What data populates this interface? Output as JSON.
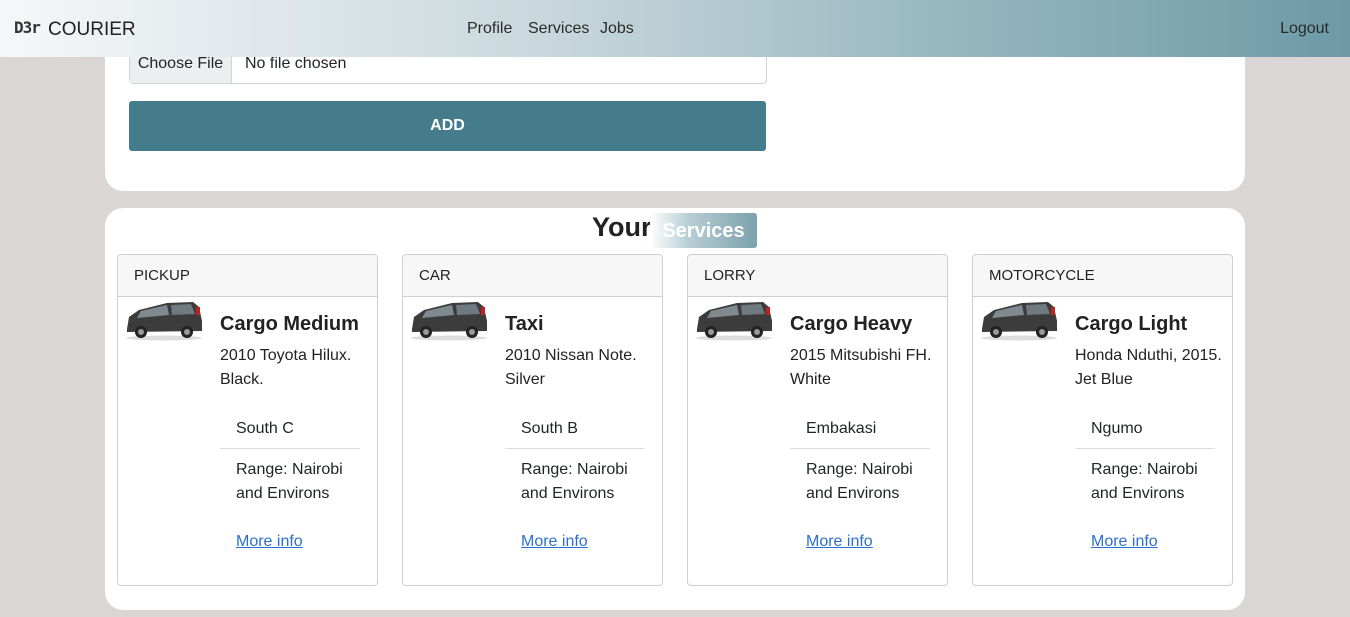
{
  "nav": {
    "logo": "D3r",
    "brand": "COURIER",
    "links": [
      "Profile",
      "Services",
      "Jobs"
    ],
    "logout": "Logout"
  },
  "form": {
    "file_button": "Choose File",
    "file_status": "No file chosen",
    "add_label": "ADD"
  },
  "services": {
    "title_part1": "Your",
    "title_part2": "Services",
    "items": [
      {
        "category": "PICKUP",
        "name": "Cargo Medium",
        "description": "2010 Toyota Hilux. Black.",
        "location": "South C",
        "range": "Range: Nairobi and Environs",
        "link": "More info"
      },
      {
        "category": "CAR",
        "name": "Taxi",
        "description": "2010 Nissan Note. Silver",
        "location": "South B",
        "range": "Range: Nairobi and Environs",
        "link": "More info"
      },
      {
        "category": "LORRY",
        "name": "Cargo Heavy",
        "description": "2015 Mitsubishi FH. White",
        "location": "Embakasi",
        "range": "Range: Nairobi and Environs",
        "link": "More info"
      },
      {
        "category": "MOTORCYCLE",
        "name": "Cargo Light",
        "description": "Honda Nduthi, 2015. Jet Blue",
        "location": "Ngumo",
        "range": "Range: Nairobi and Environs",
        "link": "More info"
      }
    ]
  },
  "colors": {
    "accent": "#457c8b",
    "link": "#2b6fd0",
    "background": "#d9d6d5"
  }
}
